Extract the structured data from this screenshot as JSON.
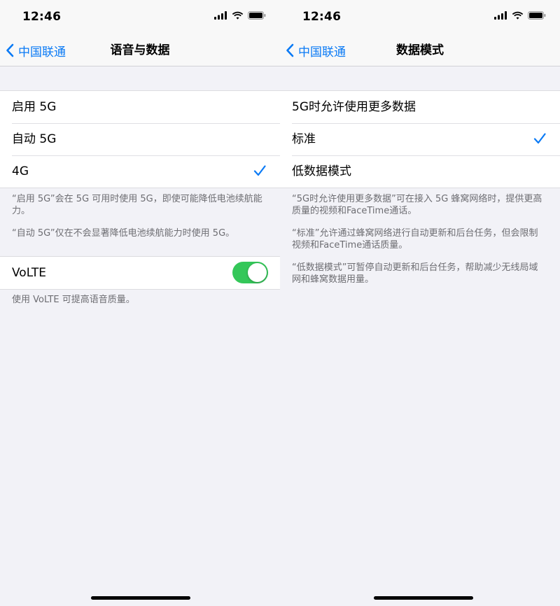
{
  "colors": {
    "accent": "#0a7af5",
    "toggle_on": "#34c759",
    "background": "#f2f2f7"
  },
  "left": {
    "status": {
      "time": "12:46"
    },
    "nav": {
      "back": "中国联通",
      "title": "语音与数据"
    },
    "options": [
      {
        "label": "启用 5G",
        "selected": false
      },
      {
        "label": "自动 5G",
        "selected": false
      },
      {
        "label": "4G",
        "selected": true
      }
    ],
    "notes": [
      "“启用 5G”会在 5G 可用时使用 5G，即使可能降低电池续航能力。",
      "“自动 5G”仅在不会显著降低电池续航能力时使用 5G。"
    ],
    "volte": {
      "label": "VoLTE",
      "enabled": true,
      "note": "使用 VoLTE 可提高语音质量。"
    }
  },
  "right": {
    "status": {
      "time": "12:46"
    },
    "nav": {
      "back": "中国联通",
      "title": "数据模式"
    },
    "options": [
      {
        "label": "5G时允许使用更多数据",
        "selected": false
      },
      {
        "label": "标准",
        "selected": true
      },
      {
        "label": "低数据模式",
        "selected": false
      }
    ],
    "notes": [
      "“5G时允许使用更多数据”可在接入 5G 蜂窝网络时，提供更高质量的视频和FaceTime通话。",
      "“标准”允许通过蜂窝网络进行自动更新和后台任务，但会限制视频和FaceTime通话质量。",
      "“低数据模式”可暂停自动更新和后台任务，帮助减少无线局域网和蜂窝数据用量。"
    ]
  }
}
